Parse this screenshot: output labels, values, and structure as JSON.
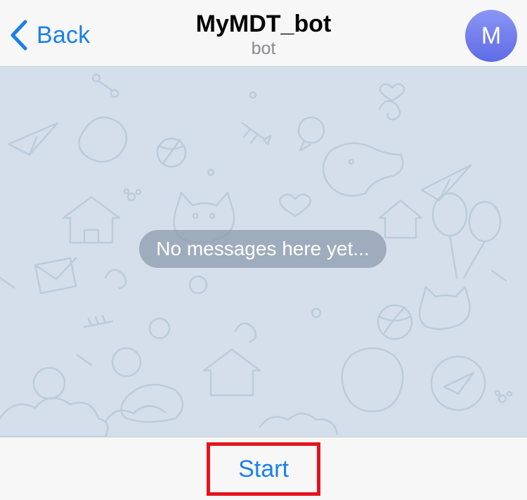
{
  "header": {
    "back_label": "Back",
    "title": "MyMDT_bot",
    "subtitle": "bot",
    "avatar_letter": "M",
    "back_icon": "chevron-left-icon"
  },
  "chat": {
    "empty_message": "No messages here yet..."
  },
  "footer": {
    "start_label": "Start"
  },
  "colors": {
    "accent": "#1a80e8",
    "highlight_border": "#e5141c",
    "chat_background": "#d4dfeb",
    "avatar_gradient_top": "#8a96f3",
    "avatar_gradient_bottom": "#5f6be6"
  }
}
